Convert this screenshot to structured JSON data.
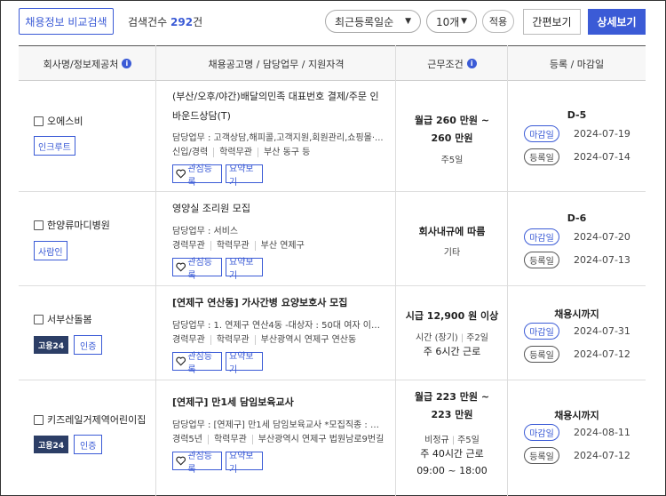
{
  "toolbar": {
    "compare_label": "채용정보 비교검색",
    "count_prefix": "검색건수",
    "count_value": "292",
    "count_suffix": "건",
    "sort_value": "최근등록일순",
    "per_page_value": "10개",
    "apply_label": "적용",
    "simple_view_label": "간편보기",
    "detail_view_label": "상세보기"
  },
  "table": {
    "headers": {
      "company": "회사명/정보제공처",
      "posting": "채용공고명 / 담당업무 / 지원자격",
      "conditions": "근무조건",
      "dates": "등록 / 마감일"
    },
    "labels": {
      "bookmark": "관심등록",
      "summary": "요약보기",
      "deadline": "마감일",
      "registered": "등록일"
    },
    "rows": [
      {
        "company": "오에스비",
        "source": "인크루트",
        "title": "(부산/오후/야간)배달의민족 대표번호 결제/주문 인바운드상담(T)",
        "duty": "담당업무 : 고객상담,해피콜,고객지원,회원관리,쇼핑몰·...",
        "quals": [
          "신입/경력",
          "학력무관",
          "부산 동구 등"
        ],
        "pay": "월급 260 만원 ~ 260 만원",
        "hours": "주5일",
        "dday": "D-5",
        "deadline": "2024-07-19",
        "registered": "2024-07-14"
      },
      {
        "company": "한양류마디병원",
        "source": "사람인",
        "title": "영양실 조리원 모집",
        "duty": "담당업무 : 서비스",
        "quals": [
          "경력무관",
          "학력무관",
          "부산 연제구"
        ],
        "pay": "회사내규에 따름",
        "hours": "기타",
        "dday": "D-6",
        "deadline": "2024-07-20",
        "registered": "2024-07-13"
      },
      {
        "company": "서부산돌봄",
        "badge": "고용24",
        "cert": "인증",
        "title": "[연제구 연산동] 가사간병 요양보호사 모집",
        "duty": "담당업무 : 1. 연제구 연산4동 -대상자 : 50대 여자 이용...",
        "quals": [
          "경력무관",
          "학력무관",
          "부산광역시 연제구 연산동"
        ],
        "pay": "시급 12,900 원 이상",
        "emp_type": "시간 (장기)",
        "days": "주2일",
        "weekly": "주 6시간 근로",
        "dday": "채용시까지",
        "deadline": "2024-07-31",
        "registered": "2024-07-12"
      },
      {
        "company": "키즈레일거제역어린이집",
        "badge": "고용24",
        "cert": "인증",
        "title": "[연제구] 만1세 담임보육교사",
        "duty": "담당업무 : [연제구] 만1세 담임보육교사 *모집직종 : 만...",
        "quals": [
          "경력5년",
          "학력무관",
          "부산광역시 연제구 법원남로9번길"
        ],
        "pay": "월급 223 만원 ~ 223 만원",
        "emp_type": "비정규",
        "days": "주5일",
        "weekly": "주 40시간 근로",
        "time": "09:00 ~ 18:00",
        "dday": "채용시까지",
        "deadline": "2024-08-11",
        "registered": "2024-07-12"
      }
    ]
  }
}
